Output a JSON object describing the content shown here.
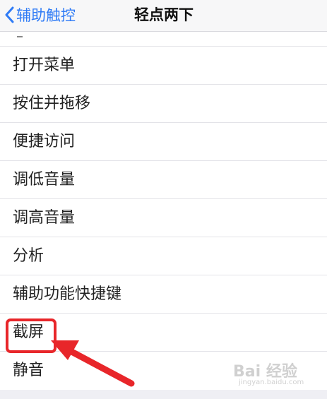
{
  "nav": {
    "back_label": "辅助触控",
    "title": "轻点两下"
  },
  "list": {
    "items": [
      "打开菜单",
      "按住并拖移",
      "便捷访问",
      "调低音量",
      "调高音量",
      "分析",
      "辅助功能快捷键",
      "截屏",
      "静音"
    ]
  },
  "annotation": {
    "highlight_color": "#e8262a",
    "highlighted_item": "截屏"
  },
  "watermark": {
    "text": "Bai 经验",
    "sub": "jingyan.baidu.com"
  },
  "colors": {
    "accent": "#2f7bf6",
    "background": "#efeff4"
  }
}
